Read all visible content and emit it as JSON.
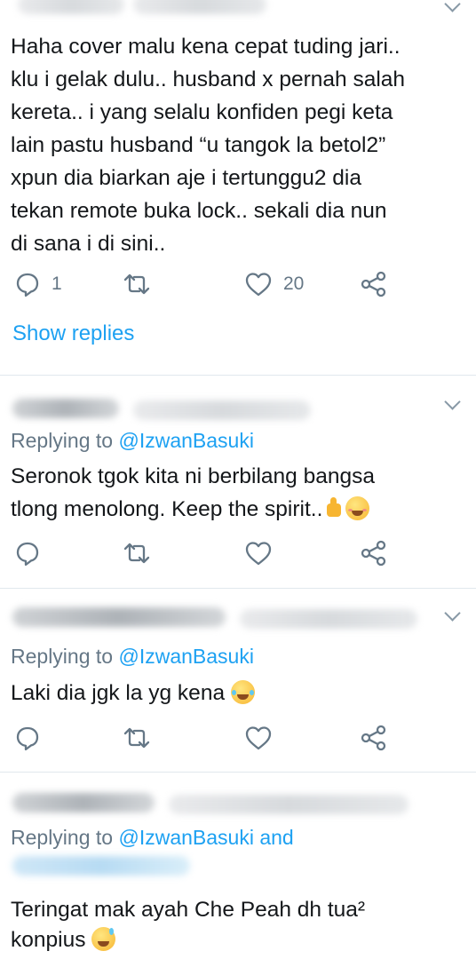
{
  "tweets": [
    {
      "text": "Haha cover malu kena cepat tuding jari..\nklu i gelak dulu.. husband x pernah salah\nkereta.. i yang selalu konfiden pegi keta\nlain pastu husband “u tangok la betol2”\nxpun dia biarkan aje i tertunggu2 dia\ntekan remote buka lock.. sekali dia nun\ndi sana i di sini..",
      "reply_count": "1",
      "like_count": "20",
      "show_replies": "Show replies"
    },
    {
      "replying_prefix": "Replying to ",
      "replying_handle": "@IzwanBasuki",
      "text": "Seronok tgok kita ni berbilang bangsa\ntlong menolong. Keep the spirit..",
      "emojis": [
        "thumbs-up",
        "smiling-face"
      ]
    },
    {
      "replying_prefix": "Replying to ",
      "replying_handle": "@IzwanBasuki",
      "text": "Laki dia jgk la yg kena",
      "emojis": [
        "face-with-tears-of-joy"
      ]
    },
    {
      "replying_prefix": "Replying to ",
      "replying_handle": "@IzwanBasuki and",
      "text": "Teringat mak ayah Che Peah dh tua²\nkonpius",
      "emojis": [
        "grinning-sweat"
      ]
    }
  ],
  "colors": {
    "link": "#1da1f2",
    "muted": "#657786",
    "text": "#14171a",
    "divider": "#e1e8ed"
  }
}
